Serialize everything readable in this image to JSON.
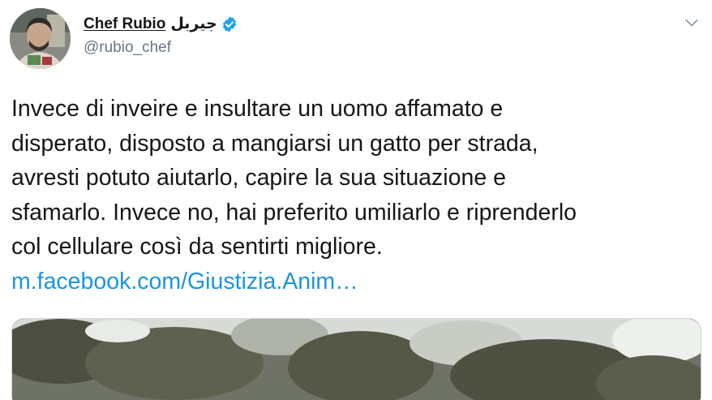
{
  "user": {
    "display_name": "Chef Rubio",
    "display_name_arabic": "جيربل",
    "handle": "@rubio_chef",
    "verified": true
  },
  "tweet": {
    "text_lines": [
      "Invece di inveire e insultare un uomo affamato e",
      "disperato, disposto a mangiarsi un gatto per strada,",
      "avresti potuto aiutarlo, capire la sua situazione e",
      "sfamarlo. Invece no, hai preferito umiliarlo e riprenderlo",
      "col cellulare così da sentirti migliore."
    ],
    "link_text": "m.facebook.com/Giustizia.Anim…"
  },
  "icons": {
    "avatar": "avatar-photo",
    "verified": "verified-badge-icon",
    "menu": "chevron-down-icon"
  },
  "colors": {
    "text": "#14171a",
    "secondary": "#657786",
    "link": "#1b95e0",
    "verified": "#1da1f2",
    "border": "#ccd6dd"
  }
}
